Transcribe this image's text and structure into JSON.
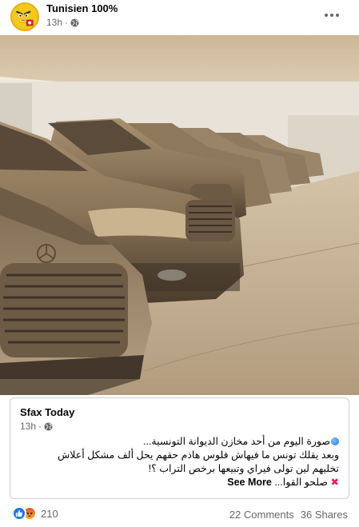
{
  "post": {
    "author": "Tunisien 100%",
    "time": "13h",
    "privacy_icon": "globe-icon",
    "menu_icon": "more-horizontal-icon"
  },
  "photo": {
    "colors": {
      "ceiling": "#d9c6a8",
      "wall": "#e4ddd2",
      "floor": "#c7b396",
      "dust_car": "#b8a386",
      "dark": "#3b2f24"
    }
  },
  "shared": {
    "page_name": "Sfax Today",
    "time": "13h",
    "text_lines": [
      "صورة اليوم من أحد مخازن الديوانة التونسية...",
      "وبعد يقلك تونس ما فيهاش فلوس هاذم حقهم يحل ألف مشكل أعلاش",
      "تخليهم لين تولى فيراي وتبيعها برخص التراب ؟!",
      "صلحو القوا..."
    ],
    "see_more": "See More"
  },
  "footer": {
    "reaction_count": "210",
    "comments": "22 Comments",
    "shares": "36 Shares",
    "reaction_icons": [
      "like-icon",
      "angry-icon"
    ]
  }
}
